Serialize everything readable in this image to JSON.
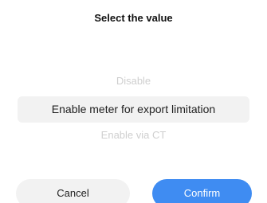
{
  "dialog": {
    "title": "Select the value"
  },
  "picker": {
    "options": [
      "Disable",
      "Enable meter for export limitation",
      "Enable via CT"
    ],
    "selected_index": 1
  },
  "actions": {
    "cancel_label": "Cancel",
    "confirm_label": "Confirm"
  },
  "colors": {
    "accent": "#3f8cf2",
    "selected_bg": "#f2f2f2",
    "disabled_text": "#cfcfcf"
  }
}
